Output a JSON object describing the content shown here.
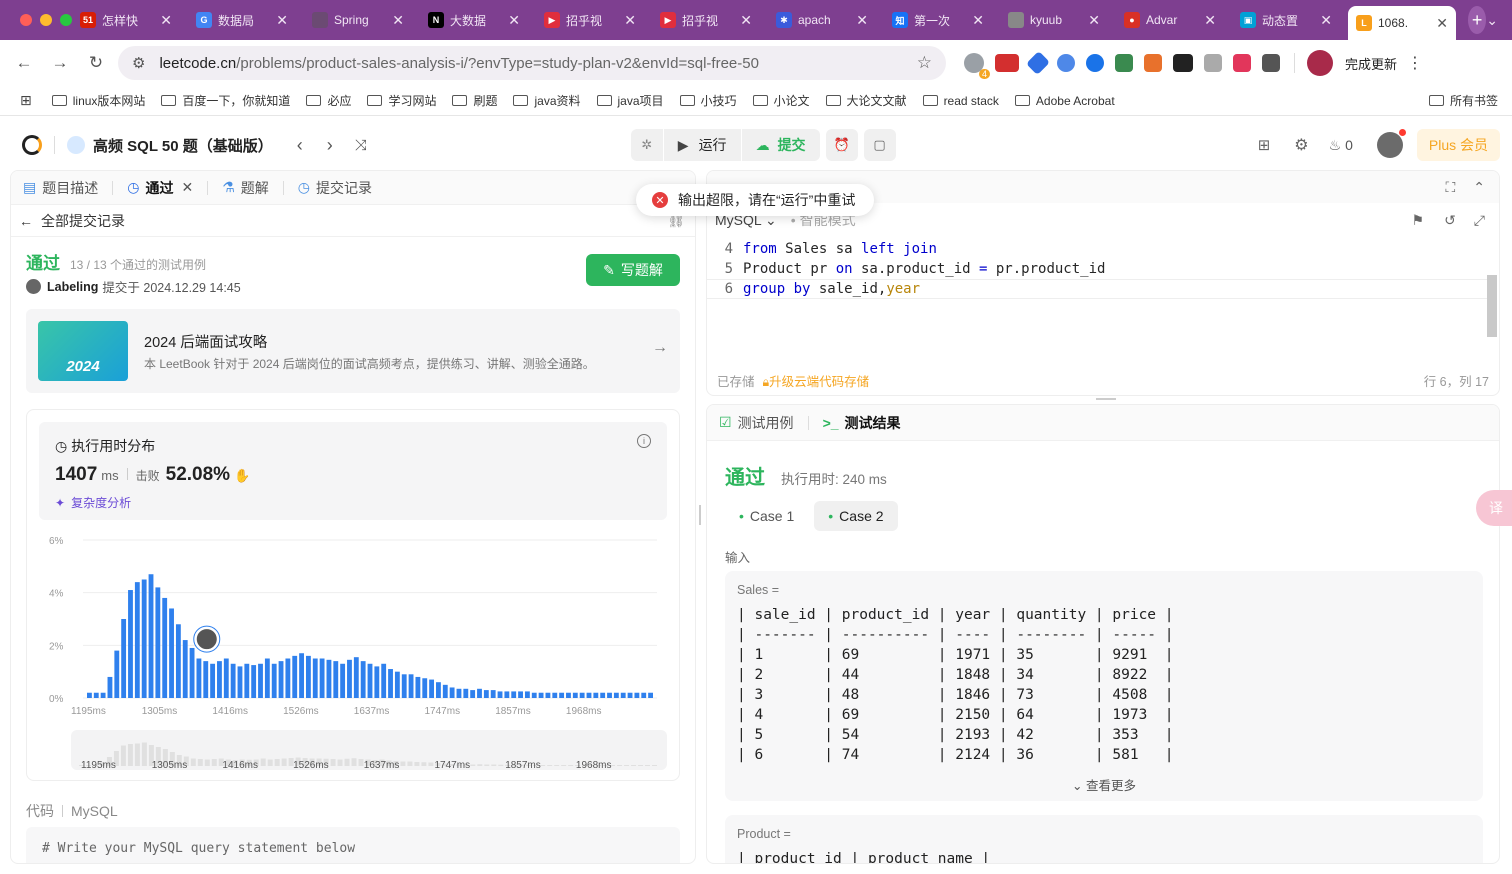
{
  "browser": {
    "tabs": [
      {
        "label": "怎样快",
        "fav_text": "51",
        "fav_color": "#d81e06"
      },
      {
        "label": "数据局",
        "fav_text": "G",
        "fav_color": "#4285f4"
      },
      {
        "label": "Spring",
        "fav_text": "",
        "fav_color": "#6b4a73"
      },
      {
        "label": "大数据",
        "fav_text": "N",
        "fav_color": "#000000"
      },
      {
        "label": "招乎视",
        "fav_text": "▶",
        "fav_color": "#e02e3d"
      },
      {
        "label": "招乎视",
        "fav_text": "▶",
        "fav_color": "#e02e3d"
      },
      {
        "label": "apach",
        "fav_text": "✱",
        "fav_color": "#3b5bdb"
      },
      {
        "label": "第一次",
        "fav_text": "知",
        "fav_color": "#1772f6"
      },
      {
        "label": "kyuub",
        "fav_text": "",
        "fav_color": "#888888"
      },
      {
        "label": "Advar",
        "fav_text": "●",
        "fav_color": "#d93025"
      },
      {
        "label": "动态置",
        "fav_text": "▣",
        "fav_color": "#00a1d6"
      },
      {
        "label": "1068.",
        "fav_text": "L",
        "fav_color": "#f89f1b"
      }
    ],
    "url_host": "leetcode.cn",
    "url_path": "/problems/product-sales-analysis-i/?envType=study-plan-v2&envId=sql-free-50",
    "ext_badge": "4",
    "update_label": "完成更新",
    "bookmarks": [
      "linux版本网站",
      "百度一下，你就知道",
      "必应",
      "学习网站",
      "刷题",
      "java资料",
      "java项目",
      "小技巧",
      "小论文",
      "大论文文献",
      "read stack",
      "Adobe Acrobat"
    ],
    "bookmarks_all": "所有书签"
  },
  "app": {
    "plan_title": "高频 SQL 50 题（基础版）",
    "run_label": "运行",
    "submit_label": "提交",
    "streak": "0",
    "plus_label": "Plus 会员"
  },
  "left": {
    "tabs": [
      "题目描述",
      "通过",
      "题解",
      "提交记录"
    ],
    "back_label": "全部提交记录",
    "status": "通过",
    "cases_text": "13 / 13 个通过的测试用例",
    "user": "Labeling",
    "submitted_at": "提交于 2024.12.29 14:45",
    "write_solution": "写题解",
    "promo_title": "2024 后端面试攻略",
    "promo_desc": "本 LeetBook 针对于 2024 后端岗位的面试高频考点，提供练习、讲解、测验全通路。",
    "promo_badge": "2024",
    "runtime_title": "执行用时分布",
    "runtime_value": "1407",
    "runtime_unit": "ms",
    "beats_label": "击败",
    "beats_value": "52.08%",
    "complexity_label": "复杂度分析",
    "code_label": "代码",
    "code_lang": "MySQL",
    "code_preview": "# Write your MySQL query statement below"
  },
  "chart_data": {
    "type": "bar",
    "title": "执行用时分布",
    "xlabel": "",
    "ylabel": "",
    "ylim": [
      0,
      6
    ],
    "y_ticks": [
      "0%",
      "2%",
      "4%",
      "6%"
    ],
    "x_ticks": [
      "1195ms",
      "1305ms",
      "1416ms",
      "1526ms",
      "1637ms",
      "1747ms",
      "1857ms",
      "1968ms"
    ],
    "values": [
      0.2,
      0.2,
      0.2,
      0.8,
      1.8,
      3.0,
      4.1,
      4.4,
      4.5,
      4.7,
      4.2,
      3.8,
      3.4,
      2.8,
      2.2,
      1.9,
      1.5,
      1.4,
      1.3,
      1.4,
      1.5,
      1.3,
      1.2,
      1.3,
      1.25,
      1.3,
      1.5,
      1.3,
      1.4,
      1.5,
      1.6,
      1.7,
      1.6,
      1.5,
      1.5,
      1.45,
      1.4,
      1.3,
      1.45,
      1.55,
      1.4,
      1.3,
      1.2,
      1.3,
      1.1,
      1.0,
      0.9,
      0.9,
      0.8,
      0.75,
      0.7,
      0.6,
      0.5,
      0.4,
      0.35,
      0.35,
      0.3,
      0.35,
      0.3,
      0.3,
      0.25,
      0.25,
      0.25,
      0.25,
      0.25,
      0.2,
      0.2,
      0.2,
      0.2,
      0.2,
      0.2,
      0.2,
      0.2,
      0.2,
      0.2,
      0.2,
      0.2,
      0.2,
      0.2,
      0.2,
      0.2,
      0.2,
      0.2
    ],
    "highlight_value": "1407ms"
  },
  "editor": {
    "lang": "MySQL",
    "smart_mode": "智能模式",
    "saved": "已存储",
    "upgrade": "升级云端代码存储",
    "cursor": "行 6，列 17",
    "lines": [
      {
        "no": "4",
        "parts": [
          [
            "from",
            "kw"
          ],
          [
            " Sales sa ",
            ""
          ],
          [
            "left",
            "kw"
          ],
          [
            " ",
            ""
          ],
          [
            "join",
            "kw"
          ]
        ]
      },
      {
        "no": "5",
        "parts": [
          [
            "Product pr ",
            ""
          ],
          [
            "on",
            "kw"
          ],
          [
            " sa.product_id ",
            ""
          ],
          [
            "=",
            "kw"
          ],
          [
            " pr.product_id",
            ""
          ]
        ]
      },
      {
        "no": "6",
        "parts": [
          [
            "group",
            "kw"
          ],
          [
            " ",
            ""
          ],
          [
            "by",
            "kw"
          ],
          [
            " sale_id,",
            ""
          ],
          [
            "year",
            "var"
          ]
        ]
      }
    ]
  },
  "toast": "输出超限，请在“运行”中重试",
  "result": {
    "tab_testcase": "测试用例",
    "tab_result": "测试结果",
    "status": "通过",
    "runtime": "执行用时: 240 ms",
    "cases": [
      "Case 1",
      "Case 2"
    ],
    "input_label": "输入",
    "sales_label": "Sales =",
    "sales_table": "| sale_id | product_id | year | quantity | price |\n| ------- | ---------- | ---- | -------- | ----- |\n| 1       | 69         | 1971 | 35       | 9291  |\n| 2       | 44         | 1848 | 34       | 8922  |\n| 3       | 48         | 1846 | 73       | 4508  |\n| 4       | 69         | 2150 | 64       | 1973  |\n| 5       | 54         | 2193 | 42       | 353   |\n| 6       | 74         | 2124 | 36       | 581   |",
    "see_more": "查看更多",
    "product_label": "Product =",
    "product_table": "| product_id | product_name |"
  }
}
